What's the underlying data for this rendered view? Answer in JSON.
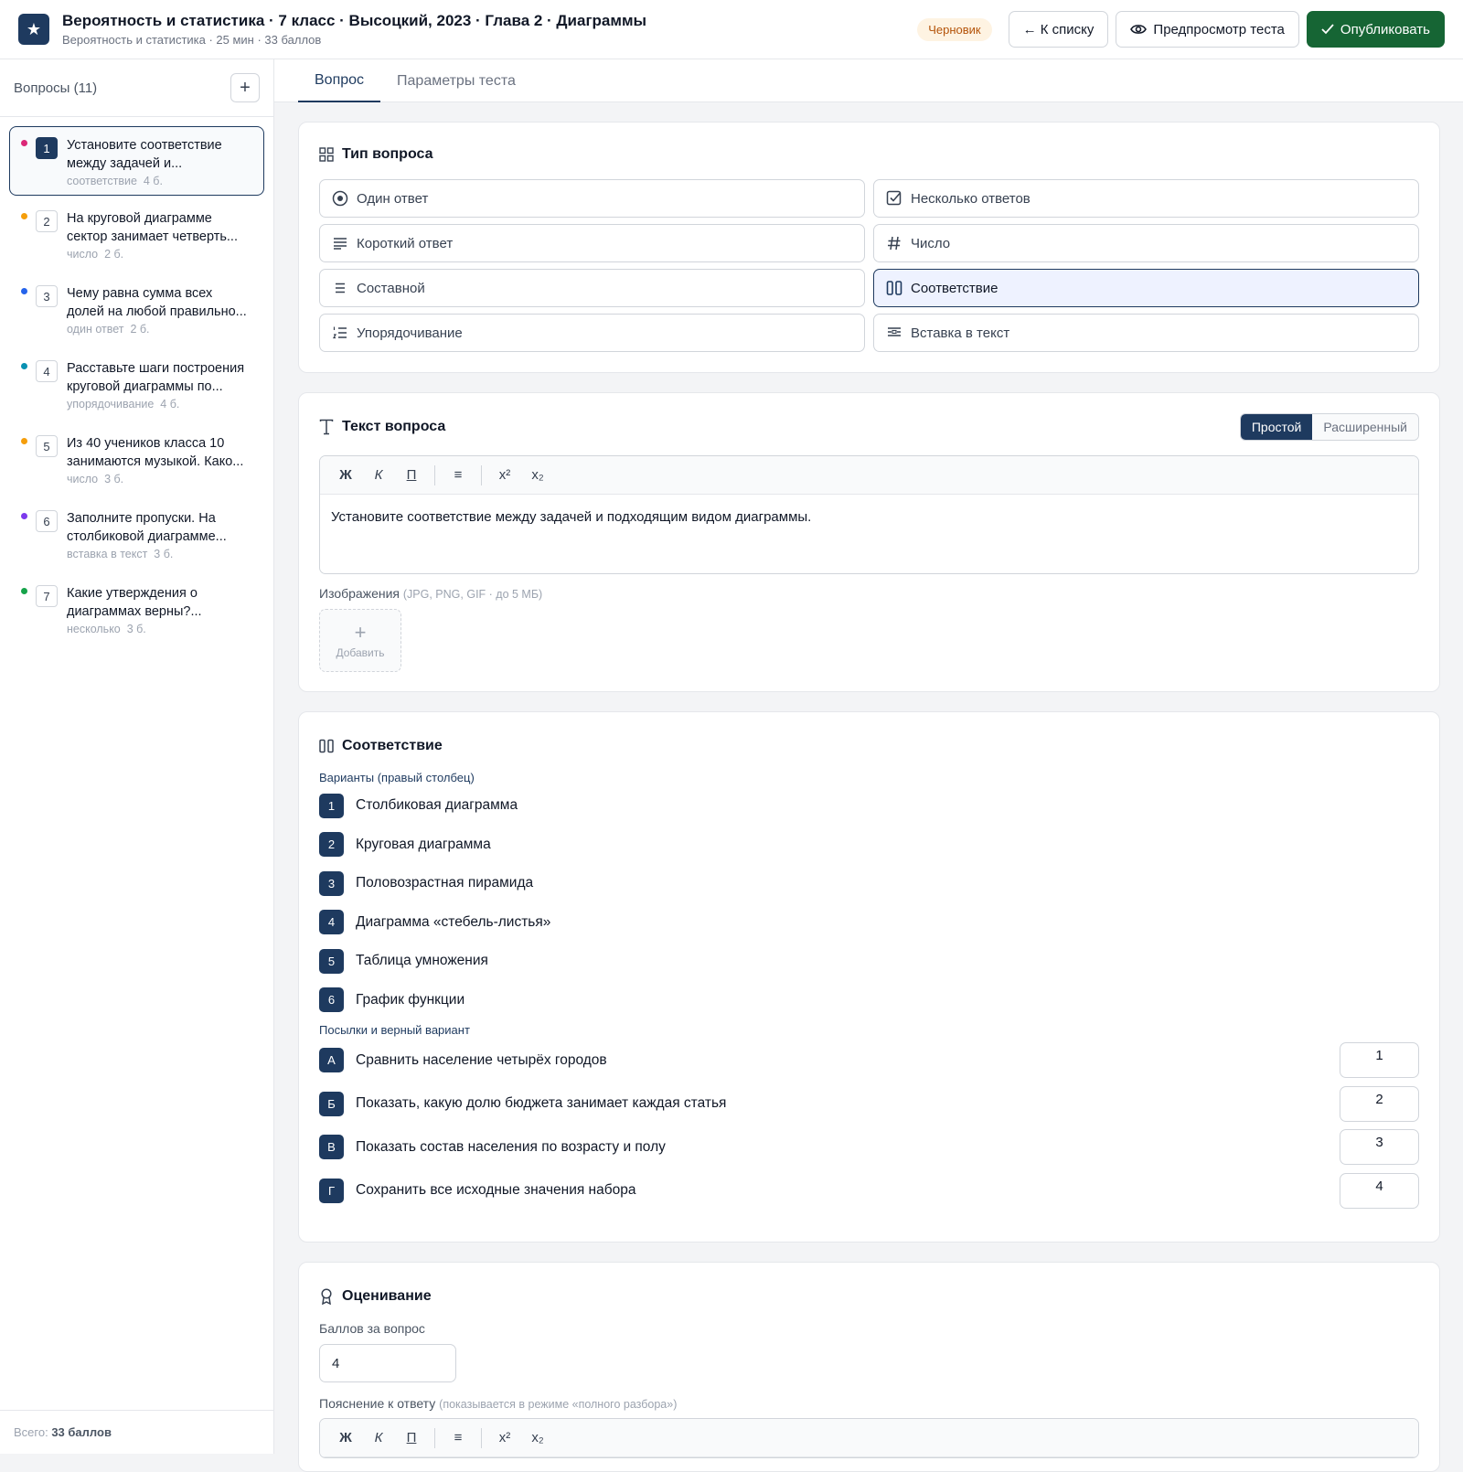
{
  "header": {
    "logo_glyph": "★",
    "title": "Вероятность и статистика · 7 класс · Высоцкий, 2023 · Глава 2 · Диаграммы",
    "subtitle": "Вероятность и статистика · 25 мин · 33 баллов",
    "status_badge": "Черновик",
    "back_label": "← К списку",
    "preview_label": "Предпросмотр теста",
    "publish_label": "Опубликовать"
  },
  "sidebar": {
    "title": "Вопросы (11)",
    "add_glyph": "+",
    "items": [
      {
        "num": "1",
        "text": "Установите соответствие между задачей и...",
        "type": "соответствие",
        "points": "4 б.",
        "color": "#db2777"
      },
      {
        "num": "2",
        "text": "На круговой диаграмме сектор занимает четверть...",
        "type": "число",
        "points": "2 б.",
        "color": "#f59e0b"
      },
      {
        "num": "3",
        "text": "Чему равна сумма всех долей на любой правильно...",
        "type": "один ответ",
        "points": "2 б.",
        "color": "#2563eb"
      },
      {
        "num": "4",
        "text": "Расставьте шаги построения круговой диаграммы по...",
        "type": "упорядочивание",
        "points": "4 б.",
        "color": "#0891b2"
      },
      {
        "num": "5",
        "text": "Из 40 учеников класса 10 занимаются музыкой. Како...",
        "type": "число",
        "points": "3 б.",
        "color": "#f59e0b"
      },
      {
        "num": "6",
        "text": "Заполните пропуски. На столбиковой диаграмме...",
        "type": "вставка в текст",
        "points": "3 б.",
        "color": "#7c3aed"
      },
      {
        "num": "7",
        "text": "Какие утверждения о диаграммах верны?...",
        "type": "несколько",
        "points": "3 б.",
        "color": "#16a34a"
      }
    ],
    "footer_label": "Всего:",
    "footer_value": "33 баллов"
  },
  "tabs": [
    {
      "label": "Вопрос"
    },
    {
      "label": "Параметры теста"
    }
  ],
  "question_type": {
    "title": "Тип вопроса",
    "options": [
      {
        "label": "Один ответ",
        "icon": "radio-icon"
      },
      {
        "label": "Несколько ответов",
        "icon": "checkbox-icon"
      },
      {
        "label": "Короткий ответ",
        "icon": "short-text-icon"
      },
      {
        "label": "Число",
        "icon": "hash-icon"
      },
      {
        "label": "Составной",
        "icon": "list-icon"
      },
      {
        "label": "Соответствие",
        "icon": "columns-icon"
      },
      {
        "label": "Упорядочивание",
        "icon": "ordered-list-icon"
      },
      {
        "label": "Вставка в текст",
        "icon": "insert-text-icon"
      }
    ],
    "selected": "Соответствие"
  },
  "question_text": {
    "title": "Текст вопроса",
    "mode_simple": "Простой",
    "mode_advanced": "Расширенный",
    "toolbar": {
      "bold": "Ж",
      "italic": "К",
      "underline": "П",
      "list": "≡",
      "sup": "x²",
      "sub": "x₂"
    },
    "body": "Установите соответствие между задачей и подходящим видом диаграммы.",
    "images_label": "Изображения",
    "images_hint": "(JPG, PNG, GIF · до 5 МБ)",
    "add_image_label": "Добавить"
  },
  "matching": {
    "title": "Соответствие",
    "options_label": "Варианты (правый столбец)",
    "options": [
      {
        "num": "1",
        "text": "Столбиковая диаграмма"
      },
      {
        "num": "2",
        "text": "Круговая диаграмма"
      },
      {
        "num": "3",
        "text": "Половозрастная пирамида"
      },
      {
        "num": "4",
        "text": "Диаграмма «стебель-листья»"
      },
      {
        "num": "5",
        "text": "Таблица умножения"
      },
      {
        "num": "6",
        "text": "График функции"
      }
    ],
    "premises_label": "Посылки и верный вариант",
    "premises": [
      {
        "letter": "А",
        "text": "Сравнить население четырёх городов",
        "answer": "1"
      },
      {
        "letter": "Б",
        "text": "Показать, какую долю бюджета занимает каждая статья",
        "answer": "2"
      },
      {
        "letter": "В",
        "text": "Показать состав населения по возрасту и полу",
        "answer": "3"
      },
      {
        "letter": "Г",
        "text": "Сохранить все исходные значения набора",
        "answer": "4"
      }
    ]
  },
  "grading": {
    "title": "Оценивание",
    "points_label": "Баллов за вопрос",
    "points_value": "4",
    "explanation_label": "Пояснение к ответу",
    "explanation_hint": "(показывается в режиме «полного разбора»)"
  },
  "colors": {
    "accent": "#1e3a5f",
    "publish": "#166534"
  }
}
